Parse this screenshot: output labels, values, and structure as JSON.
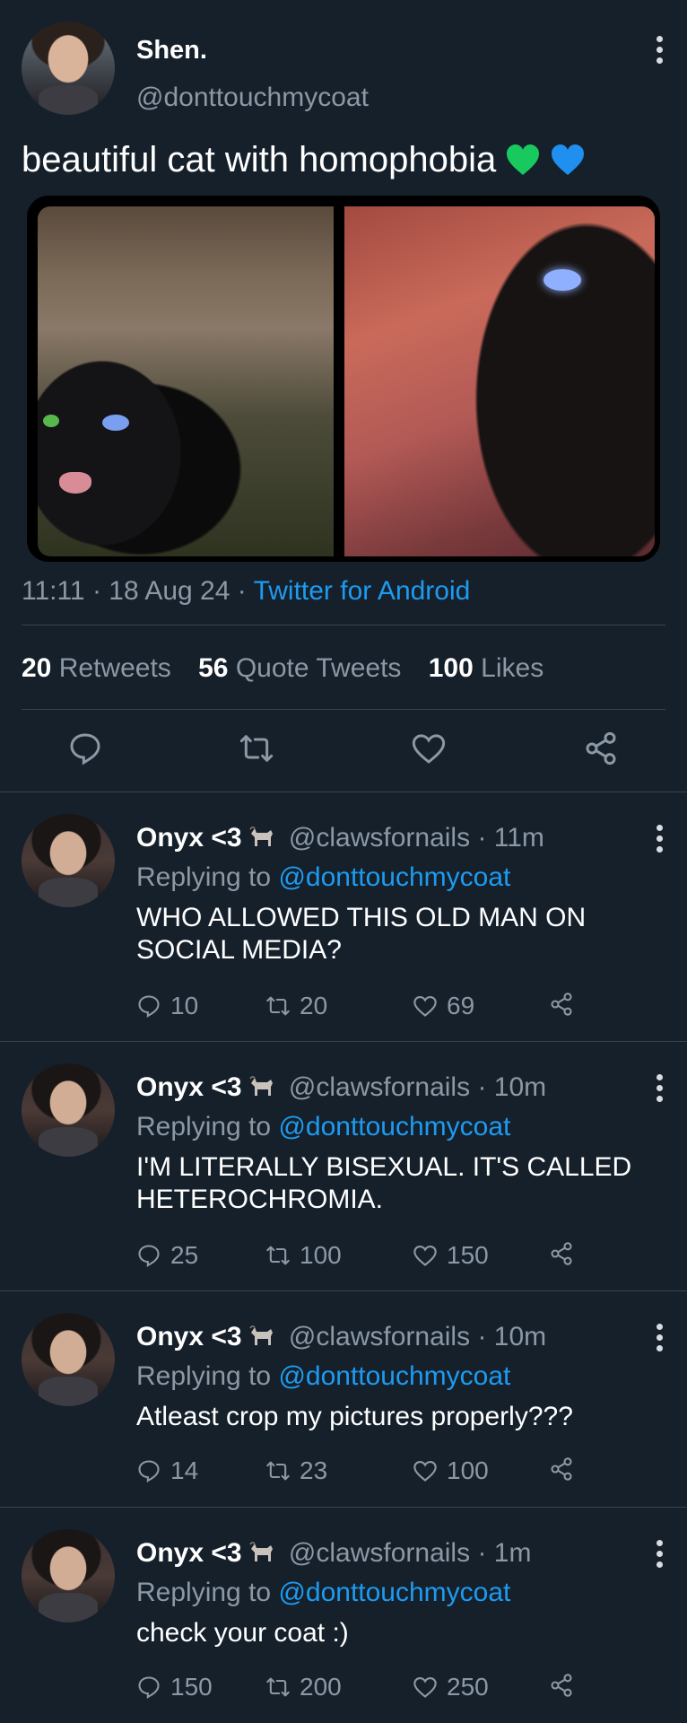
{
  "main_tweet": {
    "display_name": "Shen.",
    "handle": "@donttouchmycoat",
    "text": "beautiful cat with homophobia",
    "time": "11:11",
    "date": "18 Aug 24",
    "source": "Twitter for Android",
    "stats": {
      "retweets_count": "20",
      "retweets_label": "Retweets",
      "quotes_count": "56",
      "quotes_label": "Quote Tweets",
      "likes_count": "100",
      "likes_label": "Likes"
    },
    "icons": [
      "reply-icon",
      "retweet-icon",
      "like-icon",
      "share-icon"
    ],
    "emoji_colors": [
      "#17c95e",
      "#1f8ff0"
    ]
  },
  "replies": [
    {
      "display_name": "Onyx <3",
      "handle": "@clawsfornails",
      "age": "11m",
      "replying_prefix": "Replying to",
      "replying_to": "@donttouchmycoat",
      "text": "WHO ALLOWED THIS OLD MAN ON SOCIAL MEDIA?",
      "replies": "10",
      "retweets": "20",
      "likes": "69"
    },
    {
      "display_name": "Onyx <3",
      "handle": "@clawsfornails",
      "age": "10m",
      "replying_prefix": "Replying to",
      "replying_to": "@donttouchmycoat",
      "text": "I'M LITERALLY BISEXUAL. IT'S CALLED HETEROCHROMIA.",
      "replies": "25",
      "retweets": "100",
      "likes": "150"
    },
    {
      "display_name": "Onyx <3",
      "handle": "@clawsfornails",
      "age": "10m",
      "replying_prefix": "Replying to",
      "replying_to": "@donttouchmycoat",
      "text": "Atleast crop my pictures properly???",
      "replies": "14",
      "retweets": "23",
      "likes": "100"
    },
    {
      "display_name": "Onyx <3",
      "handle": "@clawsfornails",
      "age": "1m",
      "replying_prefix": "Replying to",
      "replying_to": "@donttouchmycoat",
      "text": "check your coat :)",
      "replies": "150",
      "retweets": "200",
      "likes": "250"
    }
  ],
  "colors": {
    "background": "#16202b",
    "link": "#1d9bf0",
    "muted": "#8b98a5",
    "divider": "#38444d"
  }
}
